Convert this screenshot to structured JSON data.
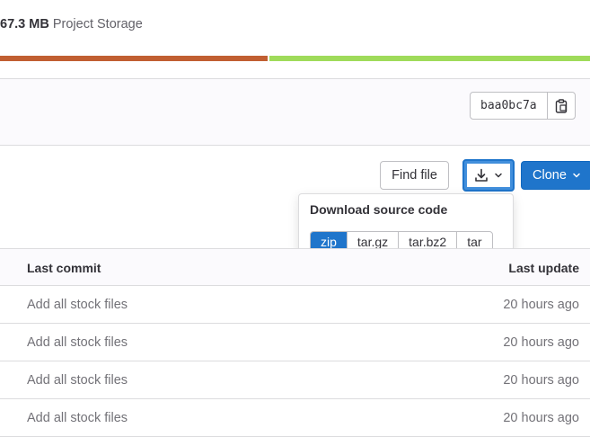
{
  "storage": {
    "size": "67.3 MB",
    "label": "Project Storage"
  },
  "commit": {
    "sha": "baa0bc7a"
  },
  "actions": {
    "find_file": "Find file",
    "clone": "Clone"
  },
  "download_popover": {
    "title": "Download source code",
    "formats": [
      "zip",
      "tar.gz",
      "tar.bz2",
      "tar"
    ],
    "selected": "zip"
  },
  "table": {
    "headers": {
      "last_commit": "Last commit",
      "last_update": "Last update"
    },
    "rows": [
      {
        "commit": "Add all stock files",
        "updated": "20 hours ago"
      },
      {
        "commit": "Add all stock files",
        "updated": "20 hours ago"
      },
      {
        "commit": "Add all stock files",
        "updated": "20 hours ago"
      },
      {
        "commit": "Add all stock files",
        "updated": "20 hours ago"
      }
    ]
  },
  "colors": {
    "accent": "#1f75cb",
    "bar_primary": "#c15f32",
    "bar_secondary": "#9fdb5a"
  }
}
